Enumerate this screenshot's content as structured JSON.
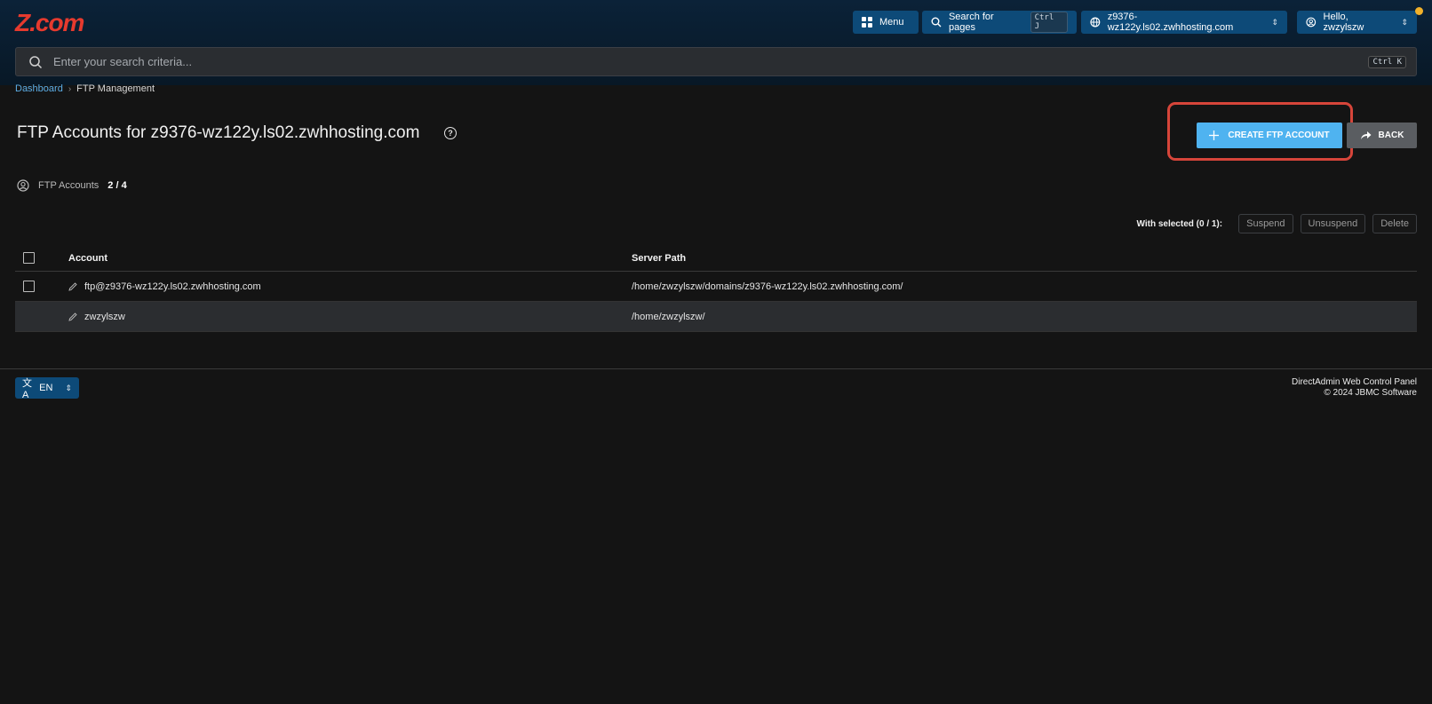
{
  "header": {
    "logo": "Z.com",
    "menu_label": "Menu",
    "search_pages_label": "Search for pages",
    "search_pages_shortcut": "Ctrl J",
    "domain_selector": "z9376-wz122y.ls02.zwhhosting.com",
    "user_label": "Hello, zwzylszw"
  },
  "search": {
    "placeholder": "Enter your search criteria...",
    "shortcut": "Ctrl K"
  },
  "breadcrumb": {
    "home": "Dashboard",
    "current": "FTP Management"
  },
  "page": {
    "title": "FTP Accounts for z9376-wz122y.ls02.zwhhosting.com",
    "create_button": "CREATE FTP ACCOUNT",
    "back_button": "BACK",
    "stat_label": "FTP Accounts",
    "stat_value": "2 / 4"
  },
  "bulk_actions": {
    "label": "With selected (0 / 1):",
    "suspend": "Suspend",
    "unsuspend": "Unsuspend",
    "delete": "Delete"
  },
  "table": {
    "headers": {
      "account": "Account",
      "path": "Server Path"
    },
    "rows": [
      {
        "account": "ftp@z9376-wz122y.ls02.zwhhosting.com",
        "path": "/home/zwzylszw/domains/z9376-wz122y.ls02.zwhhosting.com/"
      },
      {
        "account": "zwzylszw",
        "path": "/home/zwzylszw/"
      }
    ]
  },
  "footer": {
    "language": "EN",
    "line1": "DirectAdmin Web Control Panel",
    "line2": "© 2024 JBMC Software"
  },
  "colors": {
    "topbar": "#0b2238",
    "accent_button": "#0d4a78",
    "create_button": "#4fb3f0",
    "highlight_border": "#d6453a",
    "logo": "#e63a2e",
    "notification_dot": "#f1b12a"
  },
  "icons": [
    "grid-icon",
    "search-icon",
    "globe-icon",
    "user-icon",
    "help-icon",
    "plus-icon",
    "share-arrow-icon",
    "user-circle-icon",
    "pencil-icon",
    "translate-icon",
    "chevron-updown-icon"
  ]
}
